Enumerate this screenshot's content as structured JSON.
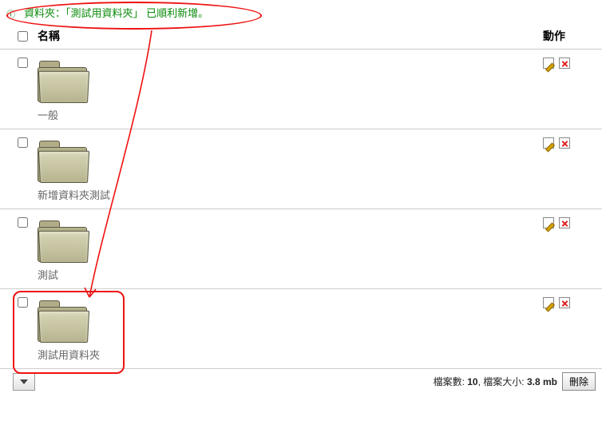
{
  "success_message": "資料夾：「測試用資料夾」 已順利新增。",
  "header": {
    "name": "名稱",
    "actions": "動作"
  },
  "rows": [
    {
      "label": "一般",
      "highlight": false
    },
    {
      "label": "新增資料夾測試",
      "highlight": false
    },
    {
      "label": "測試",
      "highlight": false
    },
    {
      "label": "測試用資料夾",
      "highlight": true
    }
  ],
  "footer": {
    "file_count_label": "檔案數:",
    "file_count": "10",
    "file_size_label": "檔案大小:",
    "file_size": "3.8 mb",
    "delete_label": "刪除"
  }
}
